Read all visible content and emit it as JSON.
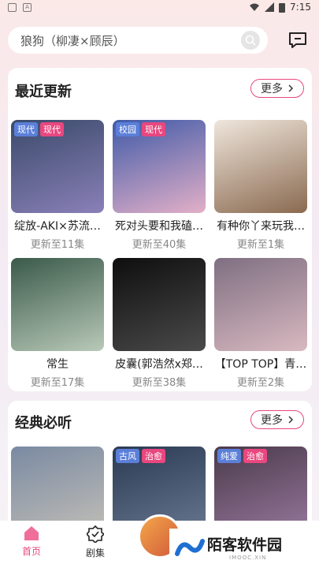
{
  "status": {
    "time": "7:15"
  },
  "search": {
    "text": "狼狗（柳凄×顾辰）"
  },
  "recent": {
    "title": "最近更新",
    "more": "更多",
    "items": [
      {
        "title": "绽放-AKI×苏流…",
        "sub": "更新至11集",
        "tags": [
          "现代",
          "现代"
        ],
        "colors": [
          "#3a4a6a",
          "#8a80b8"
        ]
      },
      {
        "title": "死对头要和我磕…",
        "sub": "更新至40集",
        "tags": [
          "校园",
          "现代"
        ],
        "colors": [
          "#3f5aa8",
          "#e3b0c8"
        ]
      },
      {
        "title": "有种你丫来玩我…",
        "sub": "更新至1集",
        "tags": [],
        "colors": [
          "#efe6dc",
          "#8a6a50"
        ]
      },
      {
        "title": "常生",
        "sub": "更新至17集",
        "tags": [],
        "colors": [
          "#3a5a4a",
          "#b9c9b8"
        ]
      },
      {
        "title": "皮囊(郭浩然x郑…",
        "sub": "更新至38集",
        "tags": [],
        "colors": [
          "#0e0e0e",
          "#4a4a4a"
        ]
      },
      {
        "title": "【TOP TOP】青…",
        "sub": "更新至2集",
        "tags": [],
        "colors": [
          "#7f6f82",
          "#d8b9c0"
        ]
      }
    ]
  },
  "classic": {
    "title": "经典必听",
    "more": "更多",
    "items": [
      {
        "tags": [],
        "colors": [
          "#7a8aa2",
          "#c4c0b8"
        ]
      },
      {
        "tags": [
          "古风",
          "治愈"
        ],
        "colors": [
          "#2a3a52",
          "#6a7a92"
        ]
      },
      {
        "tags": [
          "纯爱",
          "治愈"
        ],
        "colors": [
          "#4a3a4a",
          "#9a7aa0"
        ]
      }
    ]
  },
  "nav": {
    "home": "首页",
    "drama": "剧集"
  },
  "watermark": {
    "text": "陌客软件园",
    "sub": "IMOOC.XIN"
  }
}
